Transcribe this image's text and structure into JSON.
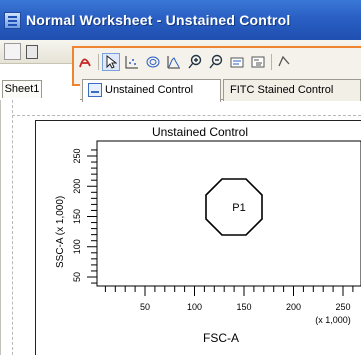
{
  "window": {
    "title": "Normal Worksheet - Unstained Control"
  },
  "sheet_tab": {
    "label": "Sheet1"
  },
  "tabs": [
    {
      "label": "Unstained Control",
      "active": true
    },
    {
      "label": "FITC Stained Control",
      "active": false
    }
  ],
  "plot": {
    "title": "Unstained Control",
    "x_label": "FSC-A",
    "x_multiplier": "(x 1,000)",
    "y_label": "SSC-A (x 1,000)",
    "x_ticks": [
      "50",
      "100",
      "150",
      "200",
      "250"
    ],
    "y_ticks": [
      "50",
      "100",
      "150",
      "200",
      "250"
    ],
    "gate_label": "P1"
  },
  "colors": {
    "titlebar": "#2a5fc4",
    "highlight_border": "#ee8430"
  }
}
